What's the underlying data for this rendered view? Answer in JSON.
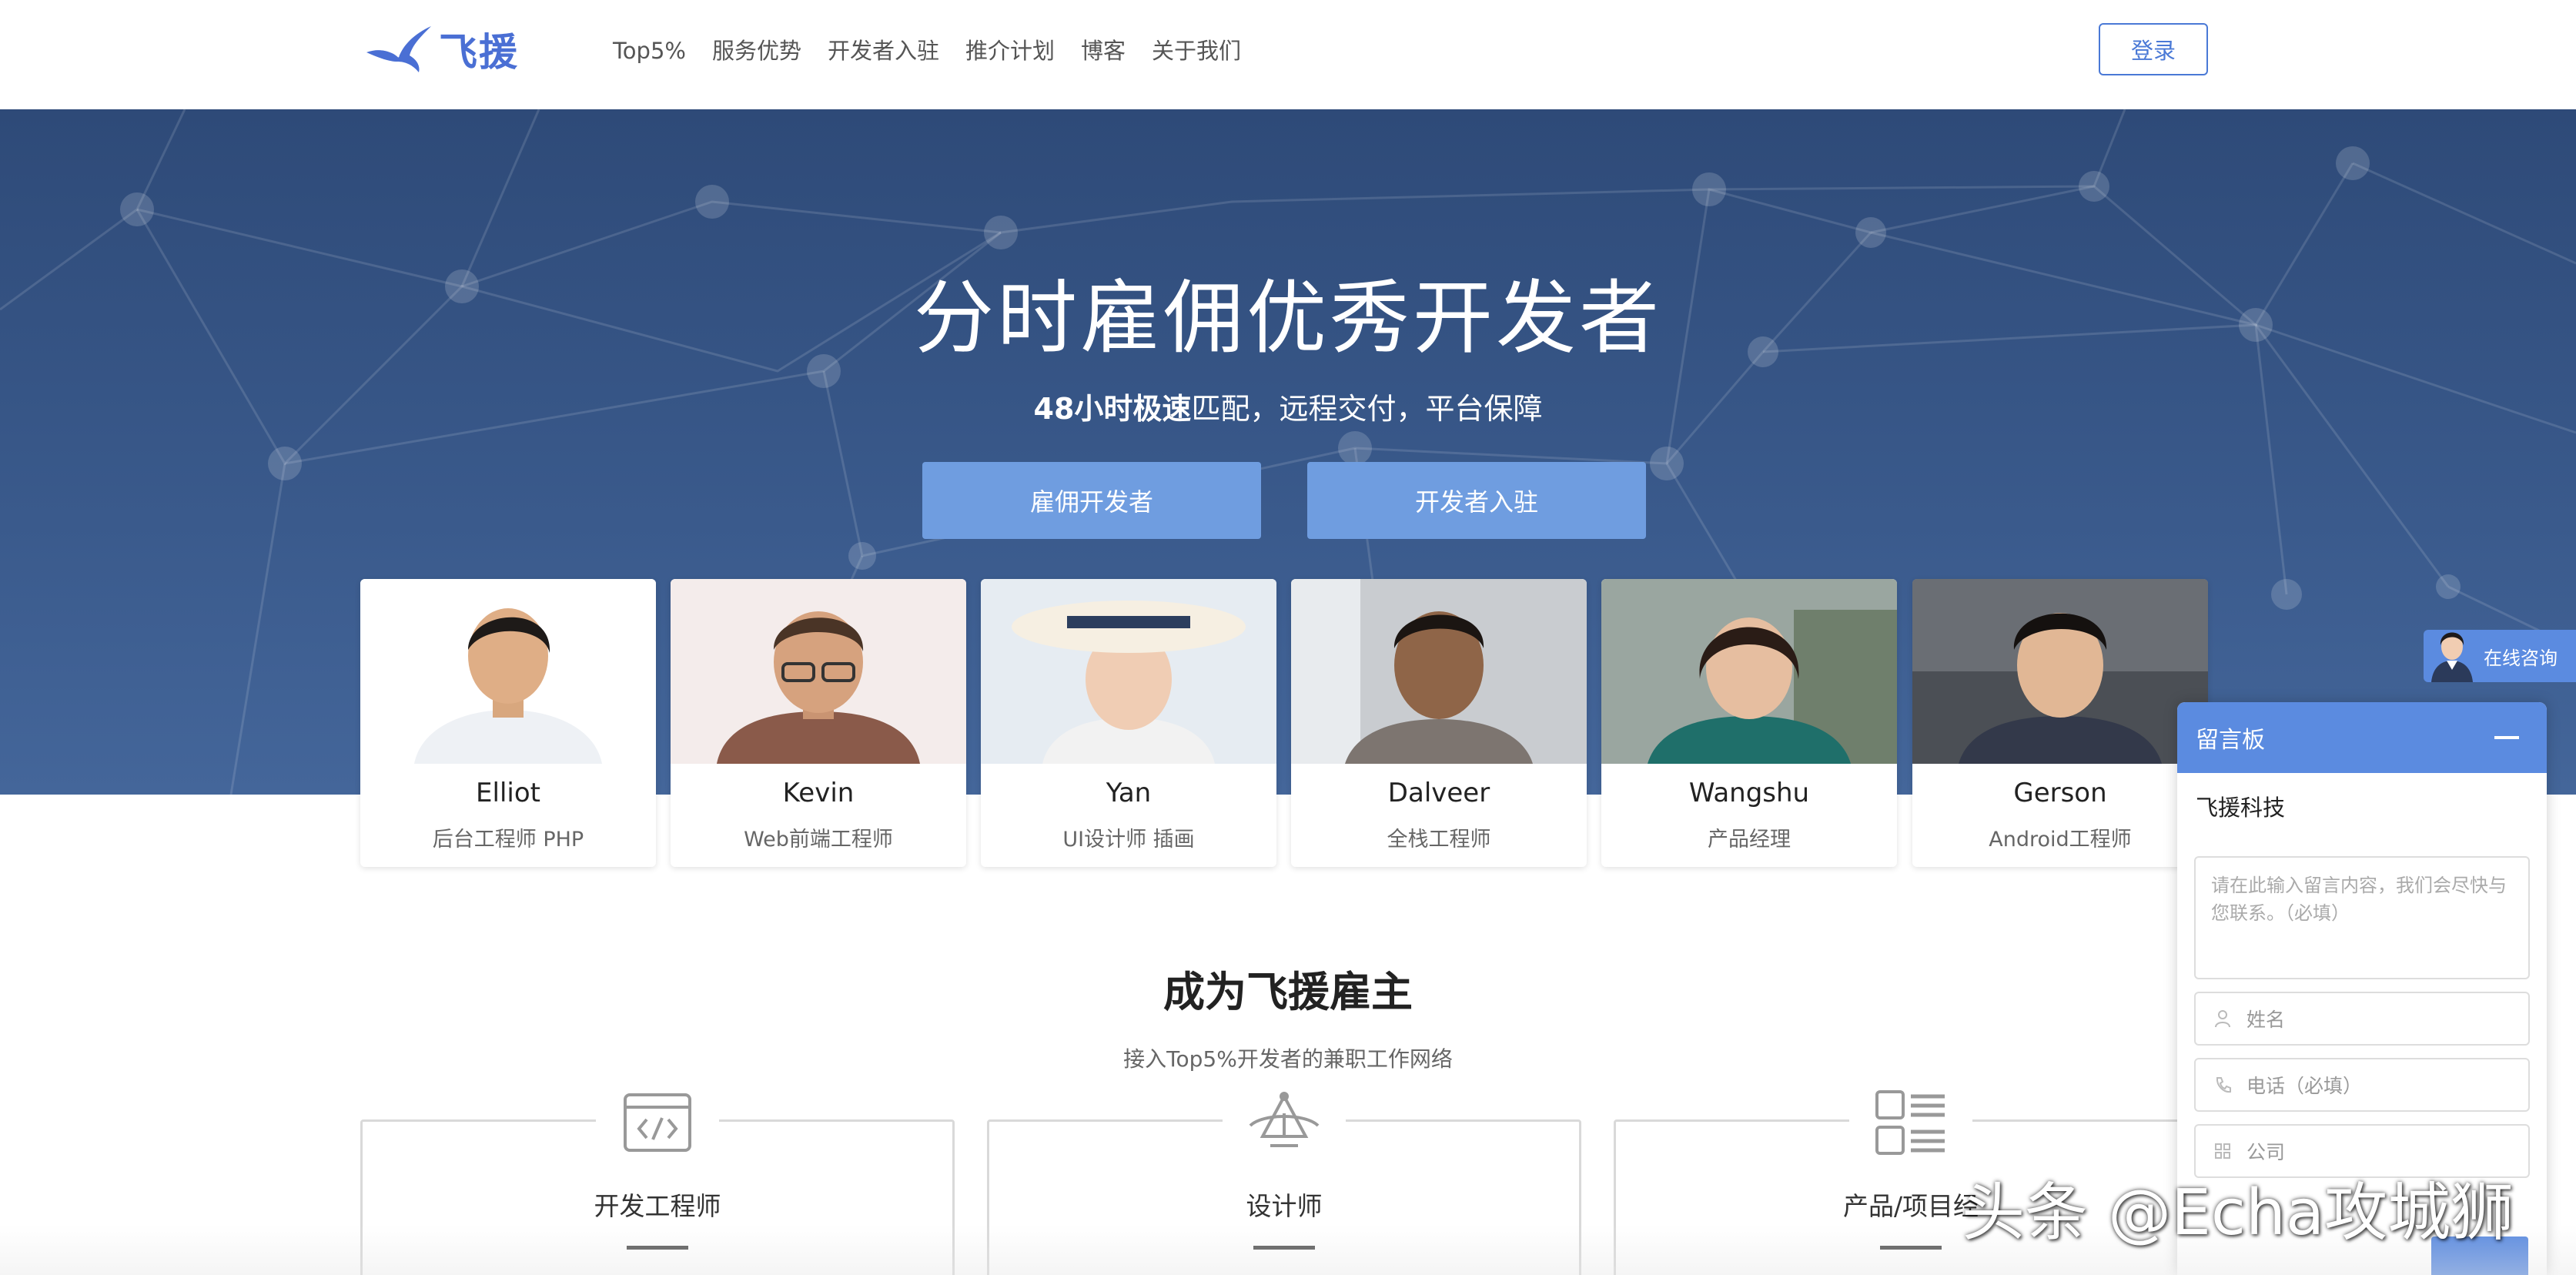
{
  "header": {
    "logo_text": "飞援",
    "nav": [
      "Top5%",
      "服务优势",
      "开发者入驻",
      "推介计划",
      "博客",
      "关于我们"
    ],
    "login_label": "登录"
  },
  "hero": {
    "title": "分时雇佣优秀开发者",
    "subtitle_bold": "48小时极速",
    "subtitle_rest": "匹配，远程交付，平台保障",
    "hire_button": "雇佣开发者",
    "join_button": "开发者入驻"
  },
  "developers": [
    {
      "name": "Elliot",
      "role": "后台工程师 PHP"
    },
    {
      "name": "Kevin",
      "role": "Web前端工程师"
    },
    {
      "name": "Yan",
      "role": "UI设计师 插画"
    },
    {
      "name": "Dalveer",
      "role": "全栈工程师"
    },
    {
      "name": "Wangshu",
      "role": "产品经理"
    },
    {
      "name": "Gerson",
      "role": "Android工程师"
    }
  ],
  "employer": {
    "title": "成为飞援雇主",
    "subtitle": "接入Top5%开发者的兼职工作网络",
    "roles": [
      "开发工程师",
      "设计师",
      "产品/项目经"
    ]
  },
  "consult": {
    "label": "在线咨询"
  },
  "message_board": {
    "title": "留言板",
    "company": "飞援科技",
    "message_placeholder": "请在此输入留言内容，我们会尽快与您联系。（必填）",
    "name_placeholder": "姓名",
    "phone_placeholder": "电话（必填）",
    "company_placeholder": "公司"
  },
  "watermark": "头条 @Echa攻城狮",
  "colors": {
    "accent": "#5b8be0",
    "hero_bg": "#3a5a8c",
    "hero_button": "#6f9de0",
    "logo": "#4a6fd4"
  }
}
